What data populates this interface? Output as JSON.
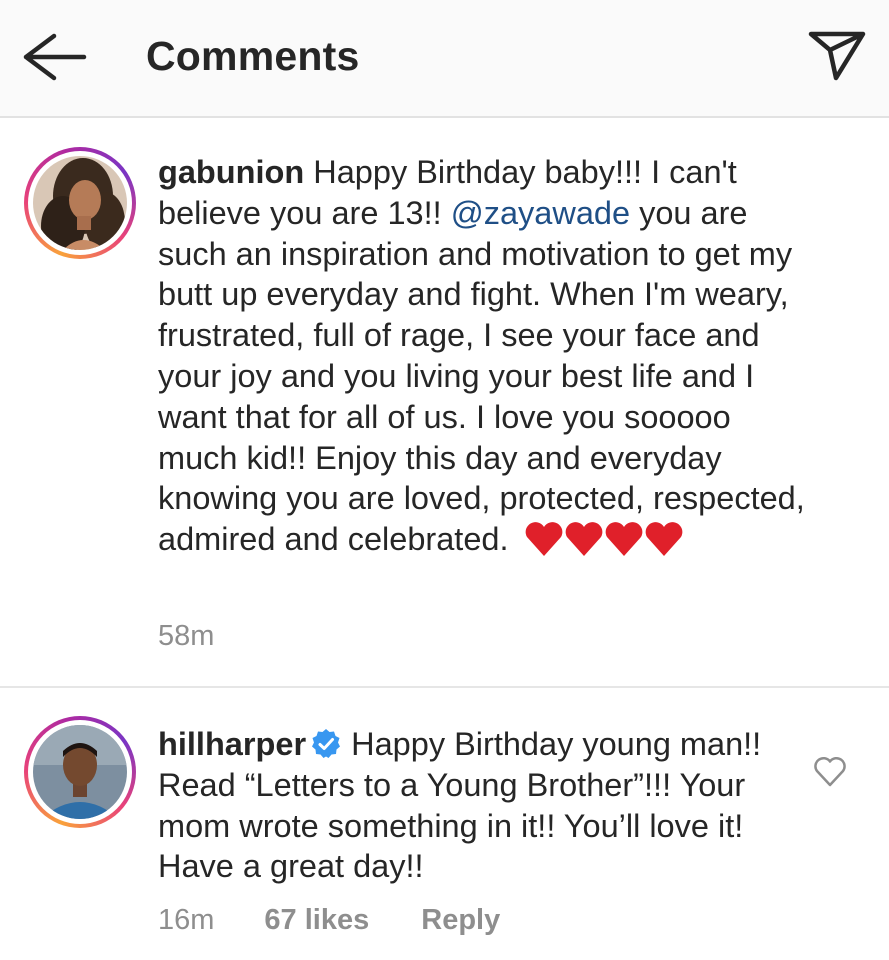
{
  "header": {
    "title": "Comments",
    "back_icon": "arrow-left-icon",
    "send_icon": "paper-plane-icon"
  },
  "comments": [
    {
      "username": "gabunion",
      "text_before_mention": "Happy Birthday baby!!! I can't believe you are 13!!",
      "mention": "@zayawade",
      "text_after_mention": "you are such an inspiration and motivation to get my butt up everyday and fight. When I'm weary, frustrated, full of rage, I see your face and your joy and you living your best life and I want that for all of us. I love you sooooo much kid!! Enjoy this day and everyday knowing you are loved, protected, respected, admired and celebrated.",
      "emoji": "❤️❤️❤️❤️",
      "time": "58m"
    },
    {
      "username": "hillharper",
      "verified": true,
      "text": "Happy Birthday young man!! Read “Letters to a Young Brother”!!! Your mom wrote something in it!! You’ll love it! Have a great day!!",
      "time": "16m",
      "likes": "67 likes",
      "reply_label": "Reply"
    }
  ],
  "colors": {
    "mention": "#1f4f86",
    "verified": "#3897f0",
    "heart_emoji": "#e0202a",
    "meta_gray": "#8e8e8e"
  }
}
